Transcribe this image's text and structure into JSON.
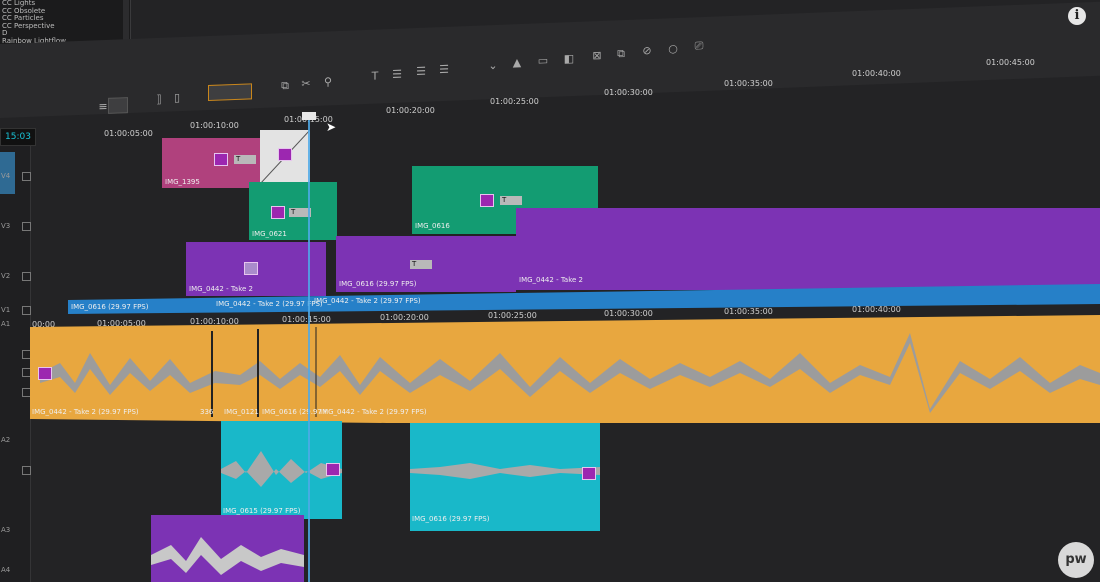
{
  "effects_panel": {
    "items": [
      "CC Lights",
      "CC Obsolete",
      "CC Particles",
      "CC Perspective",
      "D",
      "Rainbow Lightflow"
    ]
  },
  "timecode": "15:03",
  "ruler_top": [
    "01:00:05:00",
    "01:00:10:00",
    "01:00:15:00",
    "01:00:20:00",
    "01:00:25:00",
    "01:00:30:00",
    "01:00:35:00",
    "01:00:40:00",
    "01:00:45:00"
  ],
  "ruler_mid": [
    "00:00",
    "01:00:05:00",
    "01:00:10:00",
    "01:00:15:00",
    "01:00:20:00",
    "01:00:25:00",
    "01:00:30:00",
    "01:00:35:00",
    "01:00:40:00"
  ],
  "tracks": {
    "v4": "V4",
    "v3": "V3",
    "v2": "V2",
    "v1": "V1",
    "a1": "A1",
    "a2": "A2",
    "a3": "A3",
    "a4": "A4"
  },
  "clips": {
    "v4_a": "IMG_1395",
    "v3_a": "IMG_0621",
    "v3_b": "IMG_0616",
    "v2_a": "IMG_0442 - Take 2",
    "v2_b": "IMG_0616 (29.97 FPS)",
    "v2_c": "IMG_0442 - Take 2",
    "v1_a": "IMG_0616 (29.97 FPS)",
    "v1_b": "IMG_0442 - Take 2 (29.97 FPS)",
    "v1_c": "IMG_0442 - Take 2 (29.97 FPS)",
    "a1_a": "IMG_0442 - Take 2 (29.97 FPS)",
    "a1_b": "336",
    "a1_c": "IMG_0121",
    "a1_d": "IMG_0616 (29.97 I",
    "a1_e": "IMG_0442 - Take 2 (29.97 FPS)",
    "a2_a": "IMG_0615 (29.97 FPS)",
    "a2_b": "IMG_0616 (29.97 FPS)"
  },
  "t_badge": "T",
  "logo": "pw",
  "info": "i",
  "colors": {
    "magenta": "#b0417d",
    "green": "#139c72",
    "purple": "#7c33b4",
    "blue": "#2680c8",
    "orange": "#e8a73f",
    "cyan": "#19b8c9",
    "playhead": "#4fa9e8"
  }
}
